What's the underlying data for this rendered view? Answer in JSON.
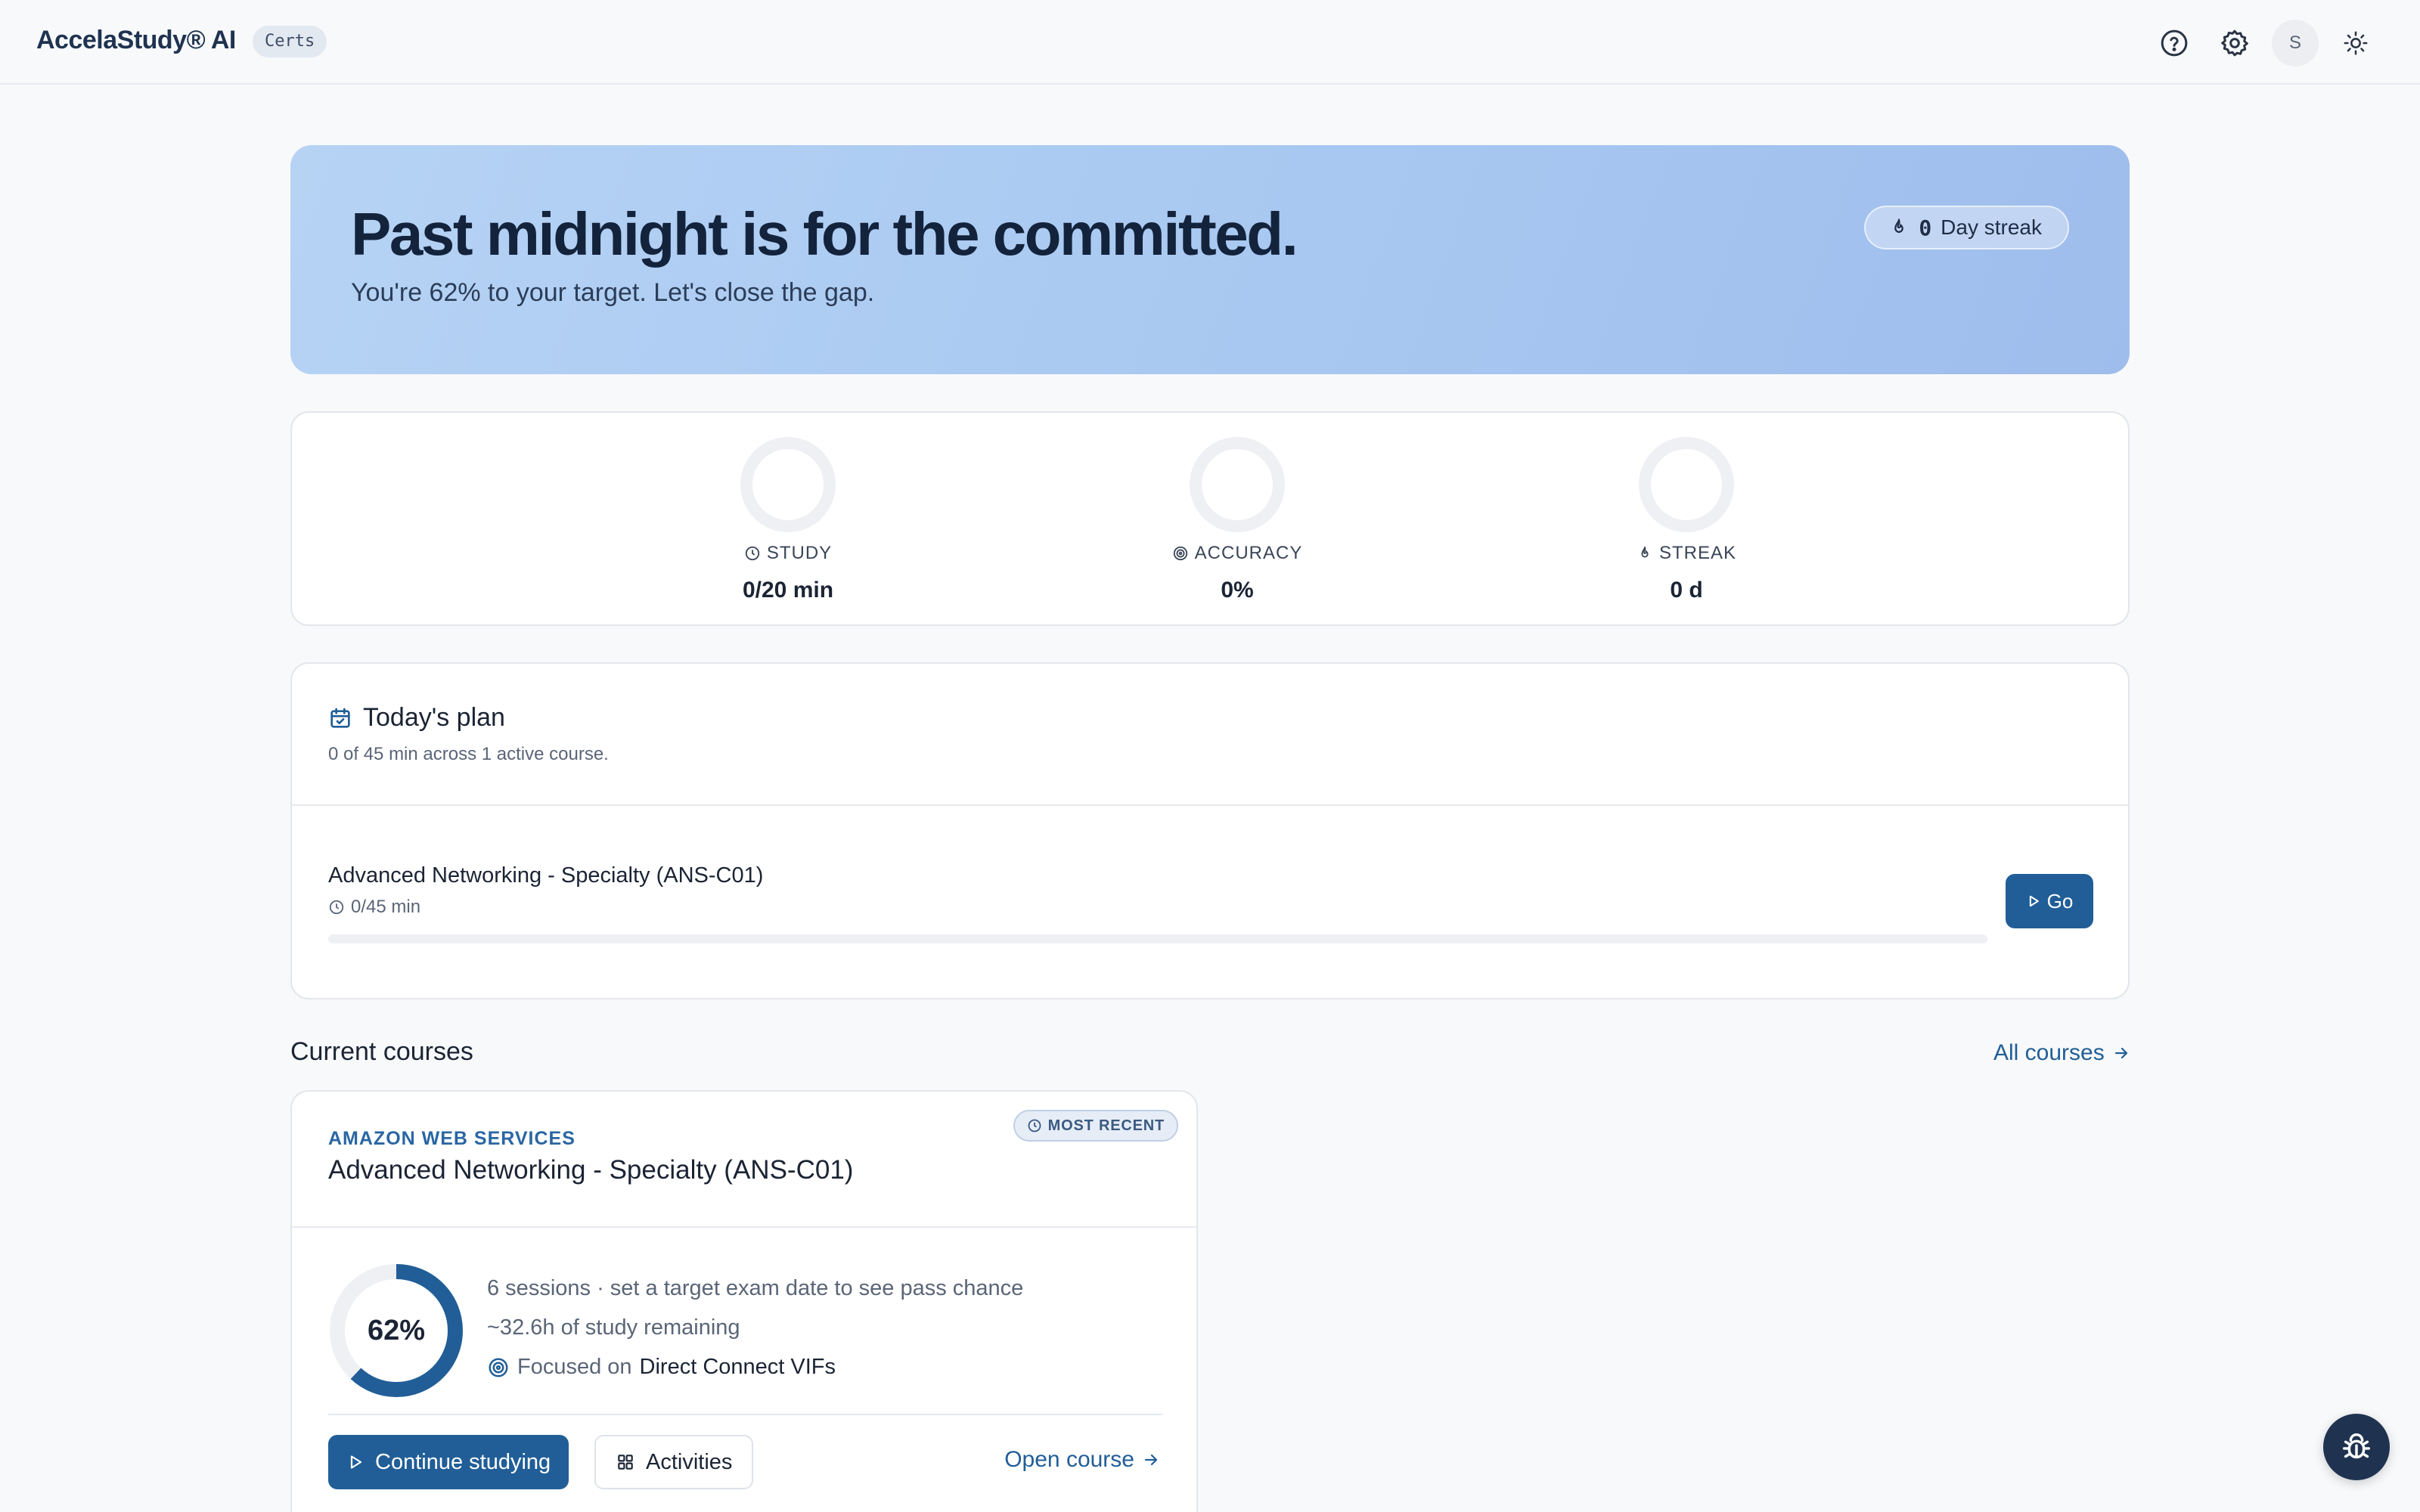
{
  "header": {
    "brand": "AccelaStudy® AI",
    "badge": "Certs",
    "avatar_initial": "S",
    "icons": [
      "help-circle-icon",
      "gear-icon",
      "avatar",
      "sun-icon"
    ]
  },
  "hero": {
    "title": "Past midnight is for the committed.",
    "subtitle": "You're 62% to your target. Let's close the gap.",
    "streak_count": "0",
    "streak_label": "Day streak"
  },
  "stats": [
    {
      "label": "STUDY",
      "value": "0/20 min",
      "progress": 0
    },
    {
      "label": "ACCURACY",
      "value": "0%",
      "progress": 0
    },
    {
      "label": "STREAK",
      "value": "0 d",
      "progress": 0
    }
  ],
  "plan": {
    "title": "Today's plan",
    "subtitle": "0 of 45 min across 1 active course.",
    "item": {
      "course": "Advanced Networking - Specialty (ANS-C01)",
      "time": "0/45 min",
      "progress": 0,
      "button": "Go"
    }
  },
  "courses": {
    "section_title": "Current courses",
    "all_link": "All courses",
    "card": {
      "badge": "MOST RECENT",
      "provider": "AMAZON WEB SERVICES",
      "name": "Advanced Networking - Specialty (ANS-C01)",
      "progress_pct": 62,
      "progress_label": "62%",
      "line1": "6 sessions · set a target exam date to see pass chance",
      "line2": "~32.6h of study remaining",
      "focus_prefix": "Focused on",
      "focus_topic": "Direct Connect VIFs",
      "continue_button": "Continue studying",
      "activities_button": "Activities",
      "open_link": "Open course"
    }
  },
  "colors": {
    "primary": "#215e97",
    "brand": "#1f3350",
    "hero_gradient_start": "#b6d3f4",
    "hero_gradient_end": "#9fbdec",
    "ring_track": "#eef0f4"
  }
}
